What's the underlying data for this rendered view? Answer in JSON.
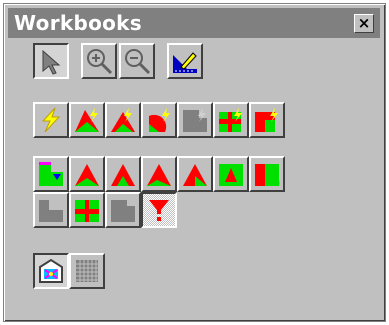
{
  "window": {
    "title": "Workbooks",
    "close_label": "×"
  },
  "colors": {
    "titlebar": "#808080",
    "face": "#c0c0c0",
    "accent_red": "#ff0000",
    "accent_green": "#00e000",
    "accent_yellow": "#ffff00"
  },
  "toolbar_rows": [
    {
      "name": "tools",
      "icons": [
        "pointer-icon",
        "zoom-in-icon",
        "zoom-out-icon",
        "drafting-icon"
      ]
    },
    {
      "name": "row-1",
      "icons": [
        "lightning-icon",
        "bolt-red-green-1-icon",
        "bolt-red-green-2-icon",
        "bolt-red-green-3-icon",
        "bolt-gray-icon",
        "bolt-red-green-4-icon",
        "bolt-red-green-5-icon"
      ]
    },
    {
      "name": "row-2",
      "icons": [
        "stack-icon",
        "shape-1-icon",
        "shape-2-icon",
        "shape-3-icon",
        "shape-4-icon",
        "shape-5-icon",
        "shape-6-icon"
      ]
    },
    {
      "name": "row-3",
      "icons": [
        "gray-shape-1-icon",
        "green-red-shape-icon",
        "gray-shape-2-icon",
        "funnel-icon"
      ]
    },
    {
      "name": "bottom",
      "icons": [
        "picture-frame-icon",
        "grid-icon"
      ]
    }
  ]
}
